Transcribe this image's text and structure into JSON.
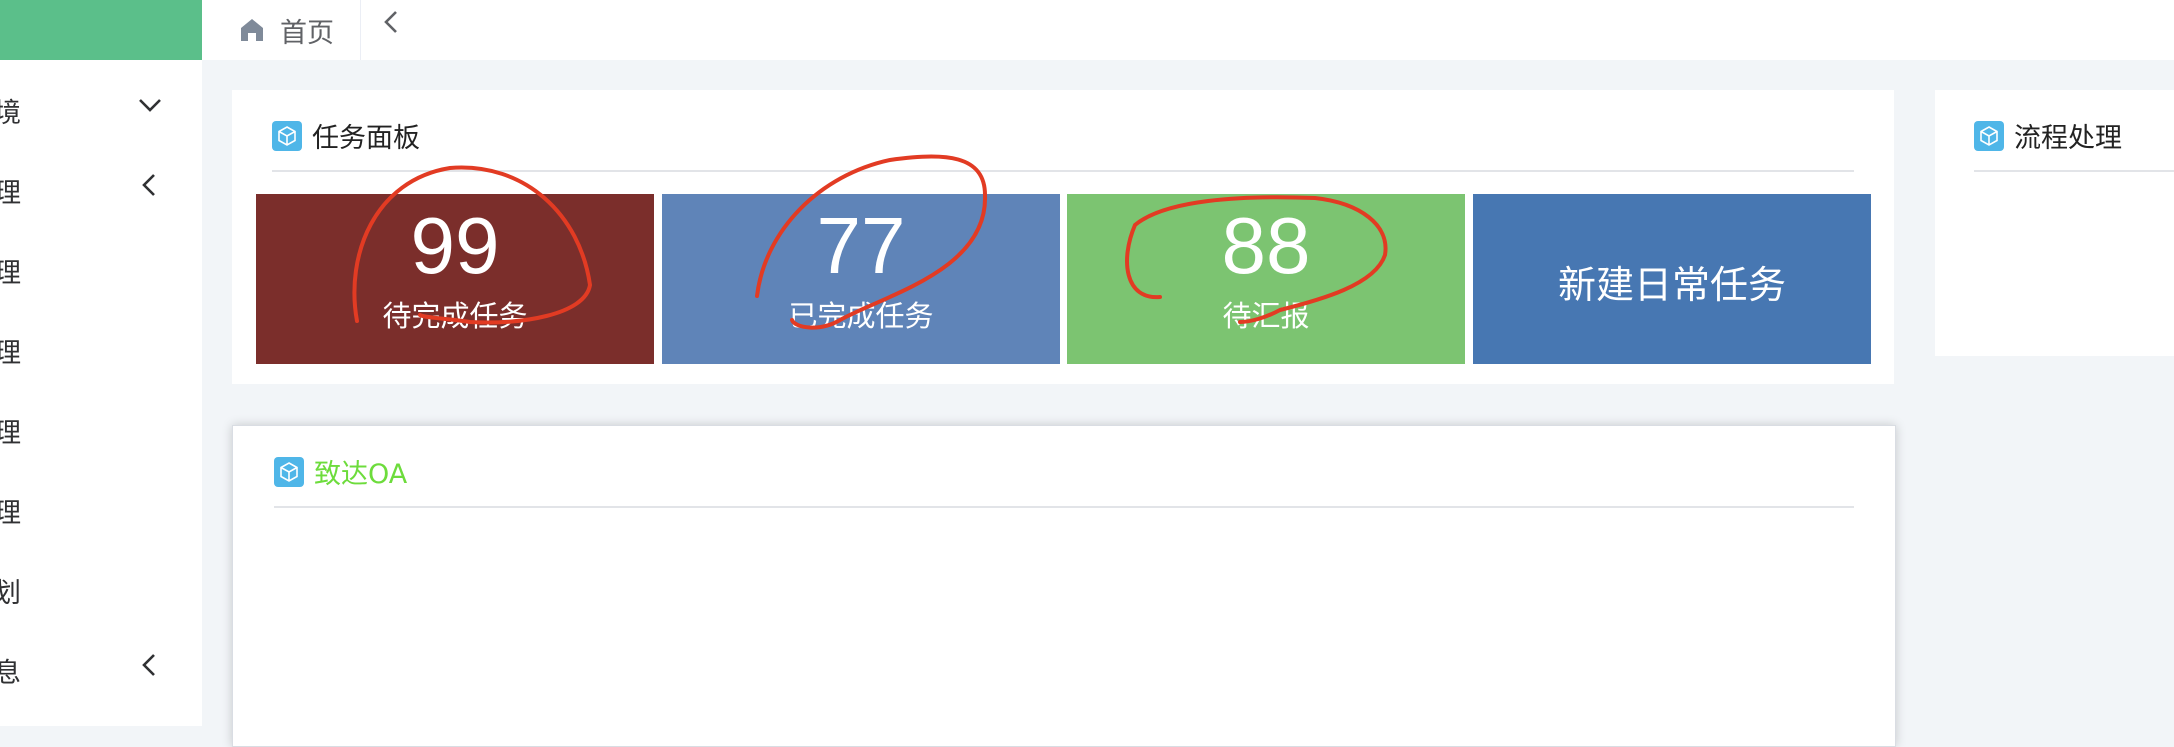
{
  "sidebar": {
    "items": [
      {
        "label": "境",
        "chevron": "down"
      },
      {
        "label": "理",
        "chevron": "left"
      },
      {
        "label": "理"
      },
      {
        "label": "理"
      },
      {
        "label": "理"
      },
      {
        "label": "理"
      },
      {
        "label": "划"
      },
      {
        "label": "息",
        "chevron": "left"
      }
    ]
  },
  "topbar": {
    "home_tab": "首页"
  },
  "task_panel": {
    "title": "任务面板",
    "tiles": [
      {
        "value": "99",
        "label": "待完成任务",
        "color": "#7b2e2b"
      },
      {
        "value": "77",
        "label": "已完成任务",
        "color": "#5f84b8"
      },
      {
        "value": "88",
        "label": "待汇报",
        "color": "#7cc471"
      },
      {
        "label": "新建日常任务",
        "color": "#4777b2"
      }
    ]
  },
  "process_panel": {
    "title": "流程处理"
  },
  "oa_panel": {
    "title": "致达OA",
    "title_color": "#6ddc3c"
  },
  "colors": {
    "accent_green": "#5bbf8a",
    "annotation_red": "#e23b23",
    "icon_blue": "#4fb6e8"
  }
}
